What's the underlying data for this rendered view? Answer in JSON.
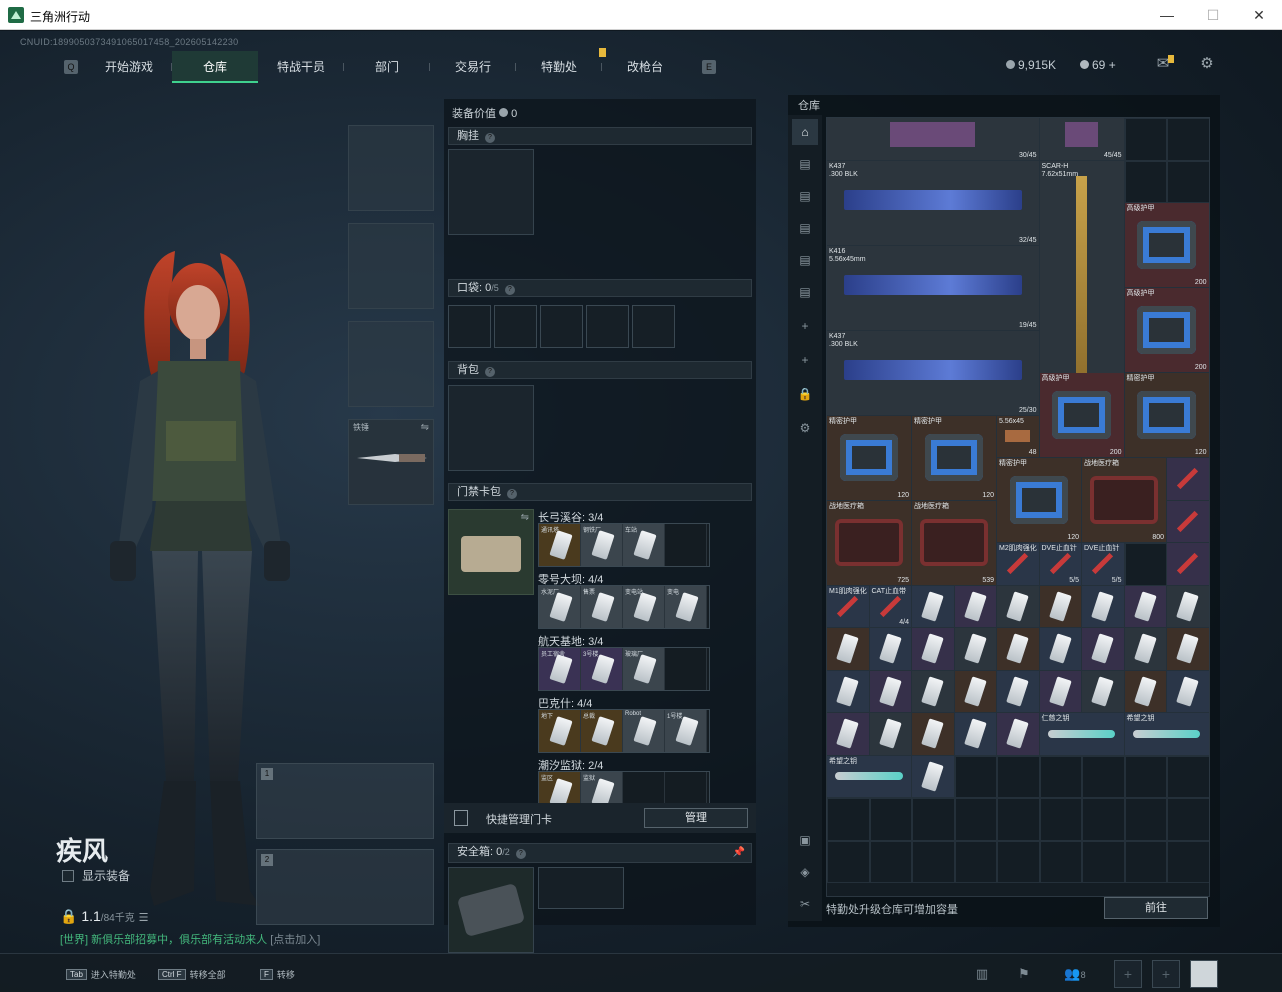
{
  "window": {
    "title": "三角洲行动",
    "minimize": "—",
    "maximize": "☐",
    "close": "✕"
  },
  "cnuid": "CNUID:189905037349106501745​8_202605142230",
  "nav": {
    "left_key": "Q",
    "right_key": "E",
    "tabs": [
      "开始游戏",
      "仓库",
      "特战干员",
      "部门",
      "交易行",
      "特勤处",
      "改枪台"
    ],
    "active": "仓库"
  },
  "currency": {
    "coins": "9,915K",
    "tokens": "69",
    "plus": "+"
  },
  "character": {
    "name": "疾风",
    "show_equipment": "显示装备",
    "weight": "1.1",
    "weight_max": "/84千克",
    "promo_green": "[世界] 新俱乐部招募中，俱乐部有活动来人",
    "promo_link": "[点击加入]"
  },
  "equip_slots": {
    "melee_label": "铁锤"
  },
  "weapon_slots": [
    "1",
    "2"
  ],
  "middle": {
    "equip_value_label": "装备价值",
    "equip_value": "0",
    "chest": "胸挂",
    "pockets": "口袋:",
    "pockets_count": "0",
    "pockets_max": "/5",
    "backpack": "背包",
    "keycard_bag": "门禁卡包",
    "maps": [
      {
        "name": "长弓溪谷: 3/4",
        "cards": [
          {
            "label": "通讯塔",
            "tone": "gold"
          },
          {
            "label": "钢铁厂",
            "tone": "white"
          },
          {
            "label": "车站",
            "tone": "white"
          },
          {
            "label": "",
            "tone": "empty"
          }
        ]
      },
      {
        "name": "零号大坝: 4/4",
        "cards": [
          {
            "label": "水泥厂",
            "tone": "white"
          },
          {
            "label": "售票",
            "tone": "white"
          },
          {
            "label": "变电站",
            "tone": "white"
          },
          {
            "label": "变电",
            "tone": "white"
          }
        ]
      },
      {
        "name": "航天基地: 3/4",
        "cards": [
          {
            "label": "员工宿舍",
            "tone": "purple"
          },
          {
            "label": "3号楼",
            "tone": "purple"
          },
          {
            "label": "玻璃厂",
            "tone": "white"
          },
          {
            "label": "",
            "tone": "empty"
          }
        ]
      },
      {
        "name": "巴克什: 4/4",
        "cards": [
          {
            "label": "地下",
            "tone": "gold"
          },
          {
            "label": "总裁",
            "tone": "gold"
          },
          {
            "label": "Robot",
            "tone": "white"
          },
          {
            "label": "1号楼",
            "tone": "white"
          }
        ]
      },
      {
        "name": "潮汐监狱: 2/4",
        "cards": [
          {
            "label": "监区",
            "tone": "gold"
          },
          {
            "label": "监狱",
            "tone": "white"
          },
          {
            "label": "",
            "tone": "empty"
          },
          {
            "label": "",
            "tone": "empty"
          }
        ]
      }
    ],
    "quick_manage": "快捷管理门卡",
    "manage_btn": "管理",
    "safe_box": "安全箱:",
    "safe_count": "0",
    "safe_max": "/2"
  },
  "storage": {
    "title": "仓库",
    "items": [
      {
        "id": "gun1",
        "name": "K437\n.300 BLK",
        "count": "32/45"
      },
      {
        "id": "gun2",
        "name": "K416\n5.56x45mm",
        "count": "19/45"
      },
      {
        "id": "gun3",
        "name": "K437\n.300 BLK",
        "count": "25/30"
      },
      {
        "id": "gun4",
        "name": "SCAR-H\n7.62x51mm",
        "count": "45/45"
      },
      {
        "id": "top1",
        "count": "30/45"
      },
      {
        "id": "top2",
        "count": "45/45"
      },
      {
        "id": "ammo",
        "name": "5.56x45",
        "count": "48"
      },
      {
        "id": "armor_a",
        "name": "高级护甲",
        "count": "200"
      },
      {
        "id": "armor_b",
        "name": "高级护甲",
        "count": "200"
      },
      {
        "id": "armor_c",
        "name": "高级护甲",
        "count": "200"
      },
      {
        "id": "armor_d",
        "name": "精密护甲",
        "count": "120"
      },
      {
        "id": "armor_e",
        "name": "精密护甲",
        "count": "120"
      },
      {
        "id": "armor_f",
        "name": "精密护甲",
        "count": "120"
      },
      {
        "id": "armor_g",
        "name": "精密护甲",
        "count": "120"
      },
      {
        "id": "med1",
        "name": "战地医疗箱",
        "count": "800"
      },
      {
        "id": "med2",
        "name": "战地医疗箱",
        "count": "725"
      },
      {
        "id": "med3",
        "name": "战地医疗箱",
        "count": "539"
      },
      {
        "id": "t1",
        "name": "M2肌肉强化",
        "count": ""
      },
      {
        "id": "t2",
        "name": "DVE止血针",
        "count": "5/5"
      },
      {
        "id": "t3",
        "name": "DVE止血针",
        "count": "5/5"
      },
      {
        "id": "t4",
        "name": "M1肌肉强化",
        "count": ""
      },
      {
        "id": "t5",
        "name": "CAT止血带",
        "count": "4/4"
      },
      {
        "id": "k1",
        "name": "仁慈之钥",
        "count": ""
      },
      {
        "id": "k2",
        "name": "希望之钥",
        "count": ""
      },
      {
        "id": "k3",
        "name": "希望之钥",
        "count": ""
      }
    ],
    "hint": "特勤处升级仓库可增加容量",
    "goto": "前往"
  },
  "footer": {
    "tab_key": "Tab",
    "tab_text": "进入特勤处",
    "ctrlf_key": "Ctrl F",
    "ctrlf_text": "转移全部",
    "f_key": "F",
    "f_text": "转移",
    "friends": "8"
  }
}
